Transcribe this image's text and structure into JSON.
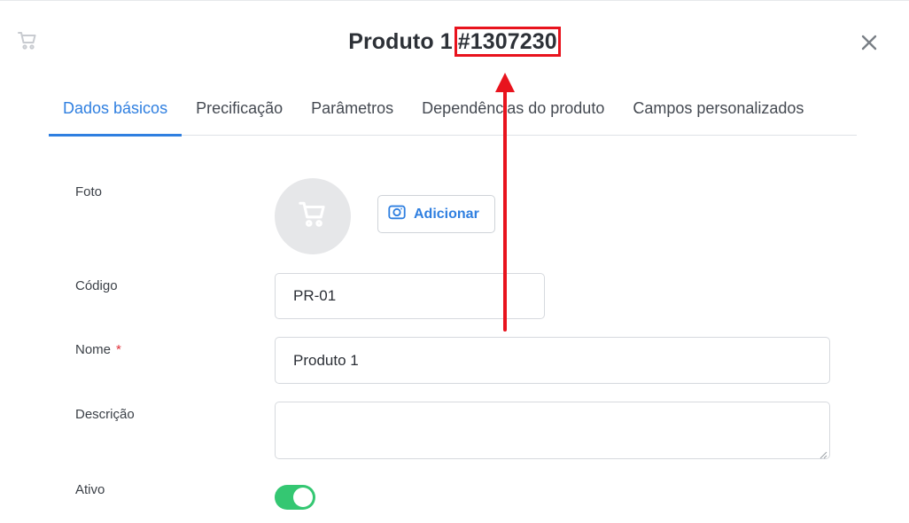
{
  "header": {
    "title": "Produto 1",
    "product_id": "#1307230"
  },
  "tabs": [
    {
      "label": "Dados básicos",
      "active": true
    },
    {
      "label": "Precificação",
      "active": false
    },
    {
      "label": "Parâmetros",
      "active": false
    },
    {
      "label": "Dependências do produto",
      "active": false
    },
    {
      "label": "Campos personalizados",
      "active": false
    }
  ],
  "form": {
    "photo_label": "Foto",
    "add_photo_label": "Adicionar",
    "code_label": "Código",
    "code_value": "PR-01",
    "name_label": "Nome",
    "required_mark": "*",
    "name_value": "Produto 1",
    "description_label": "Descrição",
    "description_value": "",
    "active_label": "Ativo",
    "active_value": true
  },
  "colors": {
    "accent": "#2f7fe0",
    "annotation": "#e8131d",
    "toggle_on": "#34c772"
  }
}
